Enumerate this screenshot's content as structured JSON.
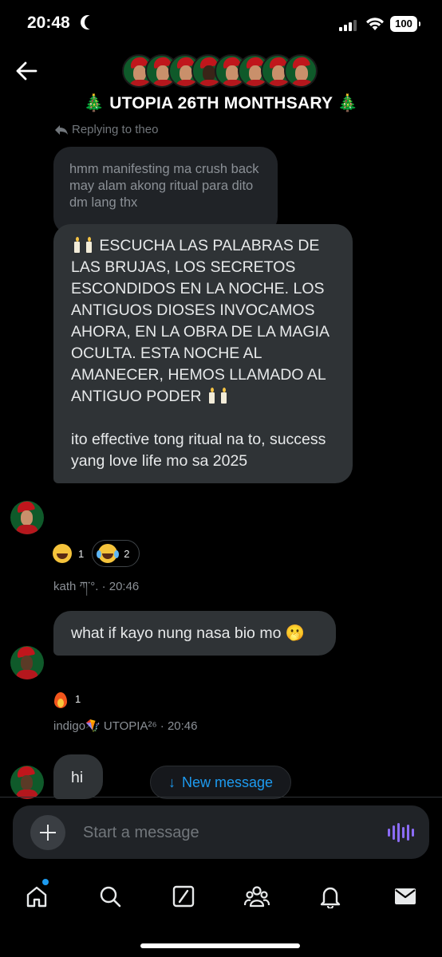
{
  "status_bar": {
    "time": "20:48",
    "battery": "100"
  },
  "header": {
    "title": "🎄 UTOPIA 26TH MONTHSARY 🎄",
    "member_avatar_count": 8
  },
  "reply": {
    "replying_to": "Replying to theo",
    "quoted_text": "hmm manifesting ma crush back may alam akong ritual para dito dm lang thx"
  },
  "messages": [
    {
      "paragraph_1": "ESCUCHA LAS PALABRAS DE LAS BRUJAS, LOS SECRETOS ESCONDIDOS EN LA NOCHE. LOS ANTIGUOS DIOSES INVOCAMOS AHORA, EN LA OBRA DE LA MAGIA OCULTA. ESTA NOCHE AL AMANECER, HEMOS LLAMADO AL ANTIGUO PODER",
      "paragraph_2": "ito effective tong ritual na to, success yang love life mo sa 2025",
      "reactions": [
        {
          "icon": "grinning-squint-emoji",
          "count": "1"
        },
        {
          "icon": "tears-of-joy-emoji",
          "count": "2"
        }
      ],
      "meta": "kath ཀ་°. · 20:46"
    },
    {
      "text": "what if kayo nung nasa bio mo 🫢",
      "reactions": [
        {
          "icon": "fire-emoji",
          "count": "1"
        }
      ],
      "meta": "indigo🪁 UTOPIA²⁶ · 20:46"
    },
    {
      "text": "hi"
    }
  ],
  "new_message_pill": {
    "arrow": "↓",
    "label": "New message"
  },
  "composer": {
    "placeholder": "Start a message"
  },
  "tabs": [
    {
      "icon": "home-icon",
      "has_notification_dot": true
    },
    {
      "icon": "search-icon"
    },
    {
      "icon": "grok-icon"
    },
    {
      "icon": "communities-icon"
    },
    {
      "icon": "notifications-bell-icon"
    },
    {
      "icon": "messages-envelope-icon"
    }
  ],
  "colors": {
    "accent": "#1d9bf0",
    "bubble": "#2f3336",
    "voice": "#8b6cf6"
  }
}
